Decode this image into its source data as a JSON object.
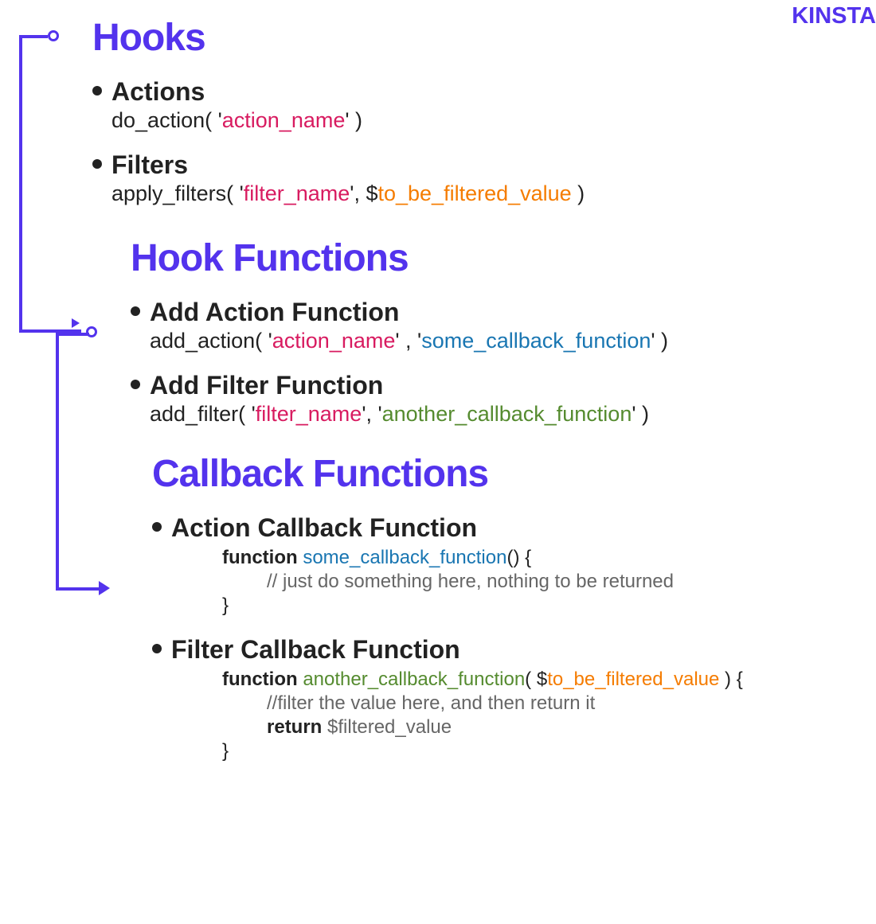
{
  "logo": "KINSTA",
  "colors": {
    "accent": "#5333ed",
    "magenta": "#d81b60",
    "orange": "#f57c00",
    "blue": "#1976b2",
    "green": "#558b2f",
    "gray": "#666"
  },
  "hooks": {
    "title": "Hooks",
    "actions": {
      "title": "Actions",
      "code_prefix": "do_action( '",
      "param": "action_name",
      "code_suffix": "' )"
    },
    "filters": {
      "title": "Filters",
      "code_prefix": "apply_filters( '",
      "param1": "filter_name",
      "mid": "', $",
      "param2": "to_be_filtered_value",
      "suffix": " )"
    }
  },
  "hook_functions": {
    "title": "Hook Functions",
    "add_action": {
      "title": "Add Action Function",
      "prefix": "add_action( '",
      "param1": "action_name",
      "mid": "' , '",
      "param2": "some_callback_function",
      "suffix": "' )"
    },
    "add_filter": {
      "title": "Add Filter Function",
      "prefix": "add_filter( '",
      "param1": "filter_name",
      "mid": "', '",
      "param2": "another_callback_function",
      "suffix": "' )"
    }
  },
  "callback_functions": {
    "title": "Callback Functions",
    "action_callback": {
      "title": "Action Callback Function",
      "line1_kw": "function ",
      "line1_name": "some_callback_function",
      "line1_suffix": "() {",
      "line2_comment": "// just do something here, nothing to be returned",
      "line3": "}"
    },
    "filter_callback": {
      "title": "Filter Callback Function",
      "line1_kw": "function ",
      "line1_name": "another_callback_function",
      "line1_open": "( $",
      "line1_param": "to_be_filtered_value",
      "line1_close": " ) {",
      "line2_comment": "//filter the value here, and then return it",
      "line3_kw": "return ",
      "line3_var": "$filtered_value",
      "line4": "}"
    }
  }
}
